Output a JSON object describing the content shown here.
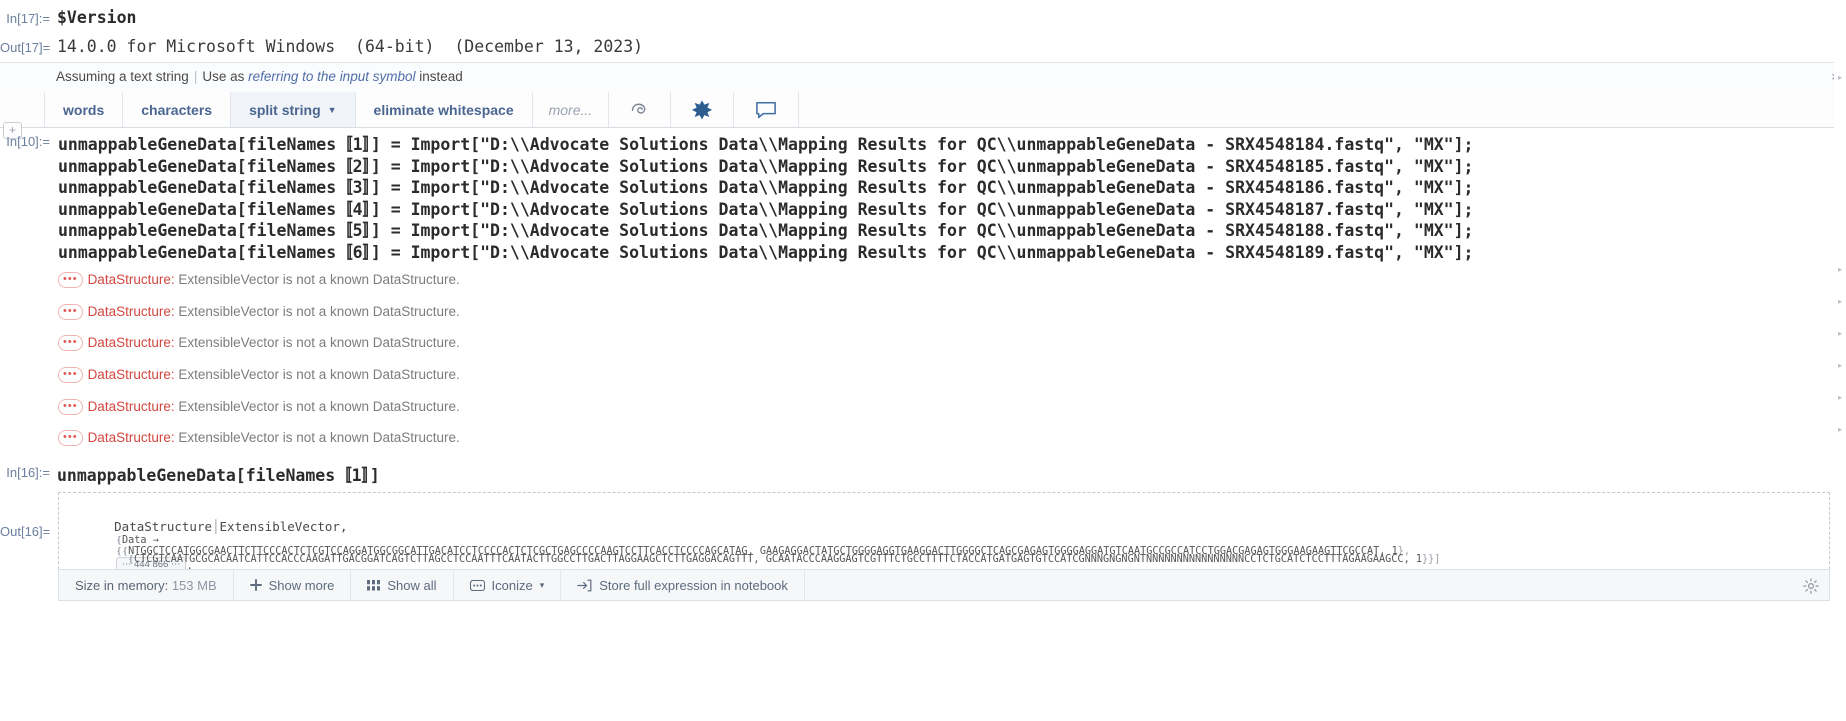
{
  "cells": {
    "version_input": {
      "label": "In[17]:=",
      "code": "$Version"
    },
    "version_output": {
      "label": "Out[17]=",
      "text": "14.0.0 for Microsoft Windows  (64-bit)  (December 13, 2023)"
    }
  },
  "suggestion_bar": {
    "assuming_text": "Assuming a text string",
    "separator": "|",
    "use_text": "Use",
    "as_text": "as",
    "italic_text": "referring to the input symbol",
    "instead_text": "instead",
    "close_icon": "×",
    "buttons": [
      {
        "label": "words",
        "has_caret": false,
        "selected": false
      },
      {
        "label": "characters",
        "has_caret": false,
        "selected": false
      },
      {
        "label": "split string",
        "has_caret": true,
        "selected": true
      },
      {
        "label": "eliminate whitespace",
        "has_caret": false,
        "selected": false
      },
      {
        "label": "more...",
        "has_caret": false,
        "selected": false
      }
    ],
    "icon_buttons": [
      {
        "name": "refresh-icon"
      },
      {
        "name": "wolfram-spikey-icon"
      },
      {
        "name": "feedback-bubble-icon"
      }
    ]
  },
  "input_cell": {
    "label": "In[10]:=",
    "plus_icon": "+",
    "lines": [
      "unmappableGeneData[fileNames〚1〛] = Import[\"D:\\\\Advocate Solutions Data\\\\Mapping Results for QC\\\\unmappableGeneData - SRX4548184.fastq\", \"MX\"];",
      "unmappableGeneData[fileNames〚2〛] = Import[\"D:\\\\Advocate Solutions Data\\\\Mapping Results for QC\\\\unmappableGeneData - SRX4548185.fastq\", \"MX\"];",
      "unmappableGeneData[fileNames〚3〛] = Import[\"D:\\\\Advocate Solutions Data\\\\Mapping Results for QC\\\\unmappableGeneData - SRX4548186.fastq\", \"MX\"];",
      "unmappableGeneData[fileNames〚4〛] = Import[\"D:\\\\Advocate Solutions Data\\\\Mapping Results for QC\\\\unmappableGeneData - SRX4548187.fastq\", \"MX\"];",
      "unmappableGeneData[fileNames〚5〛] = Import[\"D:\\\\Advocate Solutions Data\\\\Mapping Results for QC\\\\unmappableGeneData - SRX4548188.fastq\", \"MX\"];",
      "unmappableGeneData[fileNames〚6〛] = Import[\"D:\\\\Advocate Solutions Data\\\\Mapping Results for QC\\\\unmappableGeneData - SRX4548189.fastq\", \"MX\"];"
    ]
  },
  "messages": {
    "dots_icon": "•••",
    "tag": "DataStructure",
    "colon": ":",
    "body": "ExtensibleVector is not a known DataStructure.",
    "count": 6
  },
  "query_cell": {
    "label": "In[16]:=",
    "code": "unmappableGeneData[fileNames〚1〛]"
  },
  "result_cell": {
    "label": "Out[16]=",
    "header_name": "DataStructure",
    "header_arg": "ExtensibleVector,",
    "data_key": "Data →",
    "seq_line1": "NTGGCTCCATGGCGAACTTCTTCCCACTCTCGTCCAGGATGGCGGCATTGACATCCTCCCCACTCTCGCTGAGCCCCAAGTCCTTCACCTCCCCAGCATAG, GAAGAGGACTATGCTGGGGAGGTGAAGGACTTGGGGCTCAGCGAGAGTGGGGAGGATGTCAATGCCGCCATCCTGGACGAGAGTGGGAAGAAGTTCGCCAT, 1",
    "seq_line1_tail": "},",
    "badge_text": "⋯ 444 866 ⋯",
    "badge_tail": ",",
    "seq_line2": "CTCGTCAATGCGCACAATCATTCCACCCAAGATTGACGGATCAGTCTTAGCCTCCAATTTCAATACTTGGCCTTGACTTAGGAAGCTCTTGAGGACAGTTT, GCAATACCCAAGGAGTCGTTTCTGCCTTTTCTACCATGATGAGTGTCCATCGNNNGNGNGNTNNNNNNNNNNNNNNNNCCTCTGCATCTCCTTTAGAAGAAGCC, 1",
    "seq_line2_tail": "}}]"
  },
  "bottom_toolbar": {
    "size_label": "Size in memory:",
    "size_value": "153 MB",
    "items": [
      {
        "label": "Show more",
        "icon": "plus-icon"
      },
      {
        "label": "Show all",
        "icon": "grid-icon"
      },
      {
        "label": "Iconize",
        "icon": "dots-icon",
        "caret": "▾"
      },
      {
        "label": "Store full expression in notebook",
        "icon": "arrow-into-box-icon"
      }
    ],
    "gear_icon": "gear-icon"
  }
}
